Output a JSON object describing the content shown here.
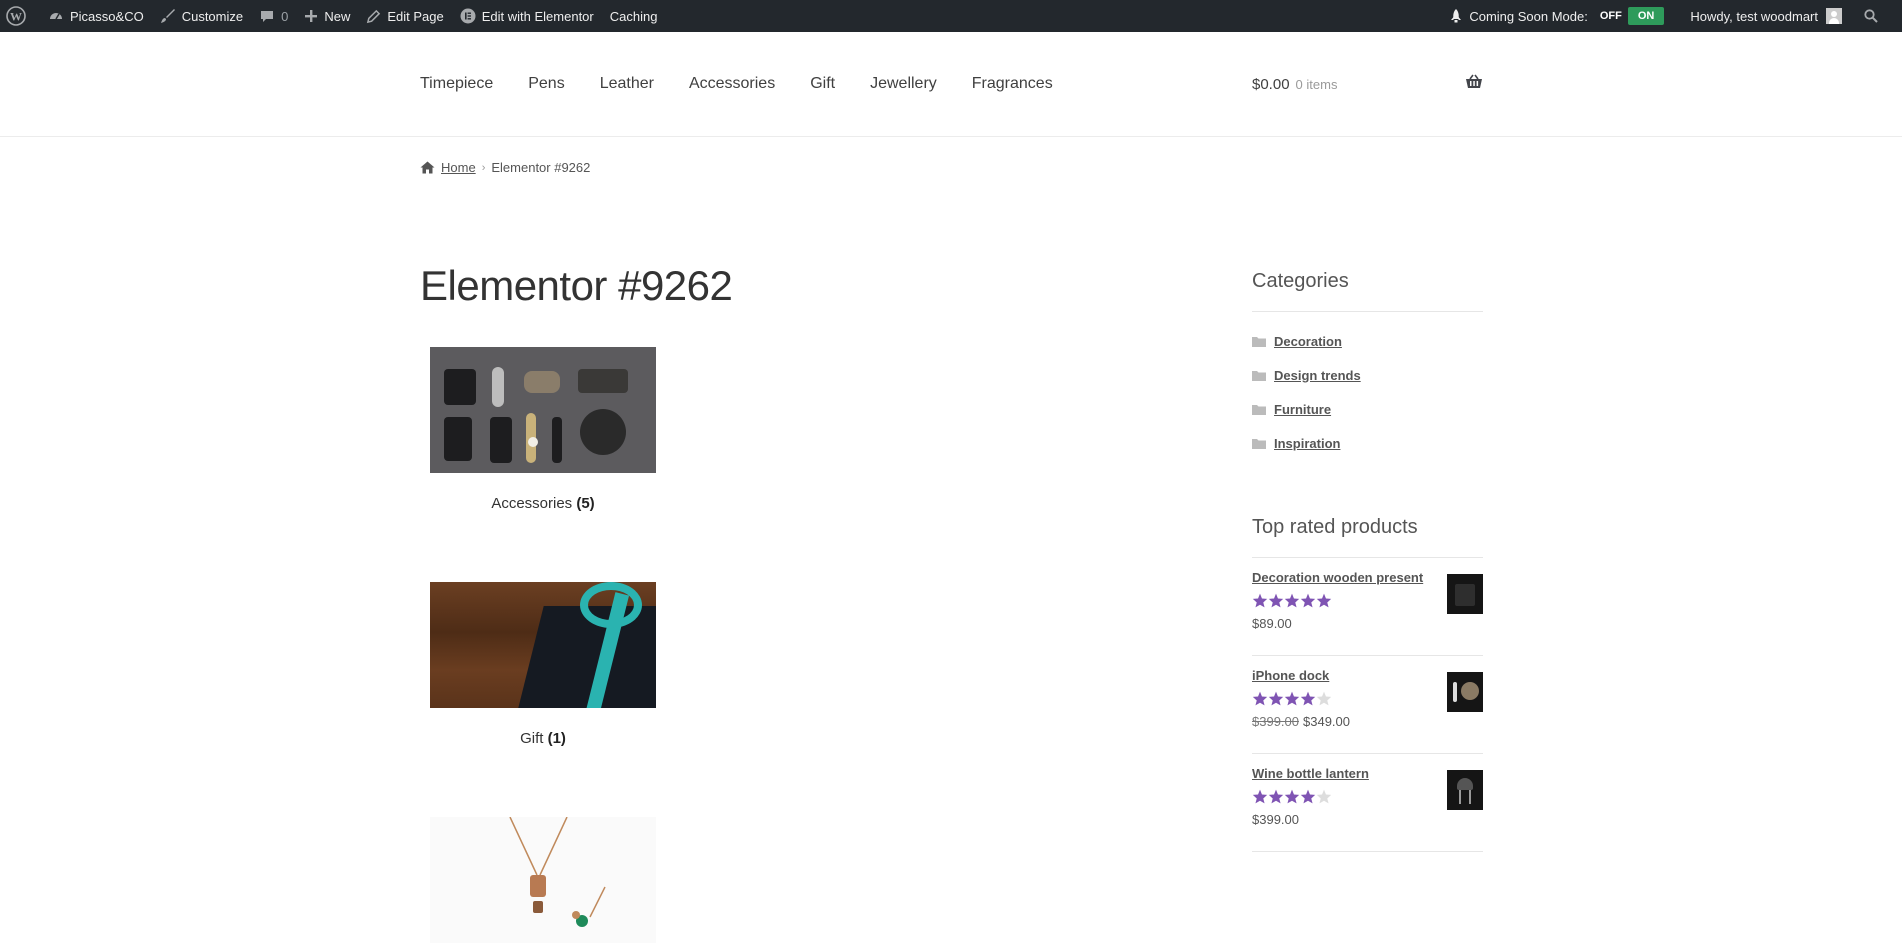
{
  "admin_bar": {
    "site_name": "Picasso&CO",
    "customize": "Customize",
    "comments_count": "0",
    "new": "New",
    "edit_page": "Edit Page",
    "edit_elementor": "Edit with Elementor",
    "caching": "Caching",
    "coming_soon": "Coming Soon Mode:",
    "toggle_off": "OFF",
    "toggle_on": "ON",
    "howdy": "Howdy, test woodmart"
  },
  "nav": {
    "items": [
      "Timepiece",
      "Pens",
      "Leather",
      "Accessories",
      "Gift",
      "Jewellery",
      "Fragrances"
    ]
  },
  "cart": {
    "amount": "$0.00",
    "count": "0 items"
  },
  "breadcrumb": {
    "home": "Home",
    "current": "Elementor #9262"
  },
  "page": {
    "title": "Elementor #9262"
  },
  "categories_grid": [
    {
      "name": "Accessories",
      "count": "(5)"
    },
    {
      "name": "Gift",
      "count": "(1)"
    },
    {
      "name": "",
      "count": ""
    }
  ],
  "sidebar": {
    "categories_title": "Categories",
    "categories": [
      "Decoration",
      "Design trends",
      "Furniture",
      "Inspiration"
    ],
    "top_rated_title": "Top rated products",
    "products": [
      {
        "name": "Decoration wooden present",
        "rating": 5,
        "old_price": "",
        "price": "$89.00"
      },
      {
        "name": "iPhone dock",
        "rating": 4,
        "old_price": "$399.00",
        "price": "$349.00"
      },
      {
        "name": "Wine bottle lantern",
        "rating": 4,
        "old_price": "",
        "price": "$399.00"
      }
    ]
  },
  "colors": {
    "admin_bg": "#23282d",
    "star": "#7f54b3",
    "toggle_on": "#2e9b5b"
  }
}
